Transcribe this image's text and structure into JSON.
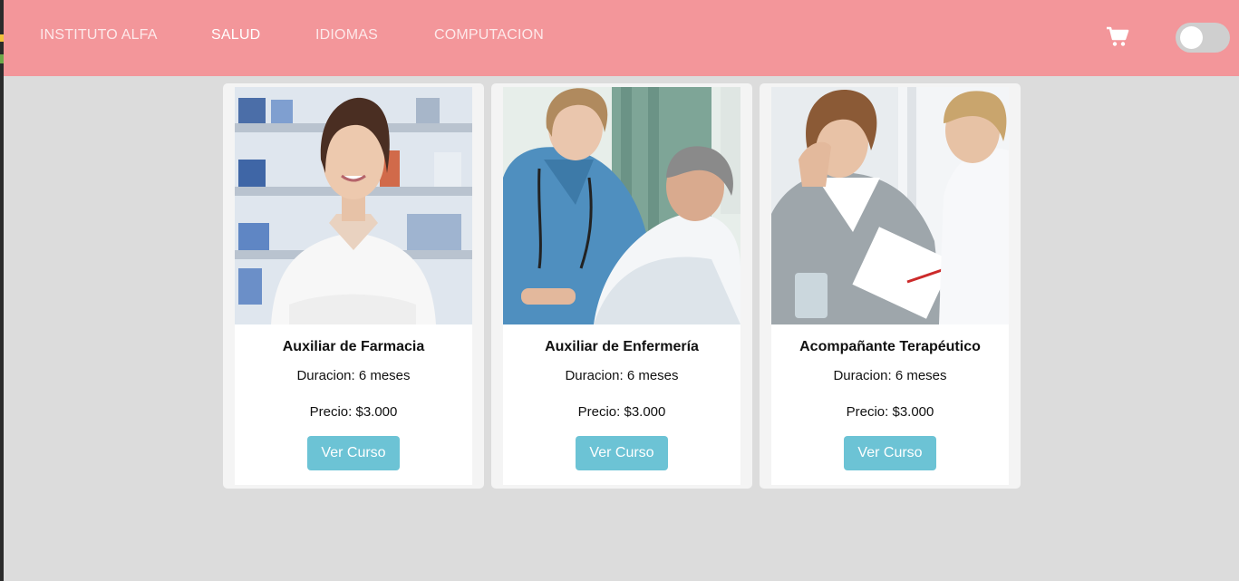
{
  "nav": {
    "brand": "INSTITUTO ALFA",
    "links": [
      "SALUD",
      "IDIOMAS",
      "COMPUTACION"
    ],
    "active": "SALUD",
    "cart_icon": "shopping-cart-icon",
    "theme_toggle": "off"
  },
  "colors": {
    "navbar": "#f3969a",
    "page_bg": "#dcdcdc",
    "button": "#6cc3d5"
  },
  "courses": [
    {
      "title": "Auxiliar de Farmacia",
      "duration": "Duracion: 6 meses",
      "price": "Precio: $3.000",
      "button": "Ver Curso",
      "image": "pharmacist-photo"
    },
    {
      "title": "Auxiliar de Enfermería",
      "duration": "Duracion: 6 meses",
      "price": "Precio: $3.000",
      "button": "Ver Curso",
      "image": "nurse-patient-photo"
    },
    {
      "title": "Acompañante Terapéutico",
      "duration": "Duracion: 6 meses",
      "price": "Precio: $3.000",
      "button": "Ver Curso",
      "image": "therapy-session-photo"
    }
  ]
}
